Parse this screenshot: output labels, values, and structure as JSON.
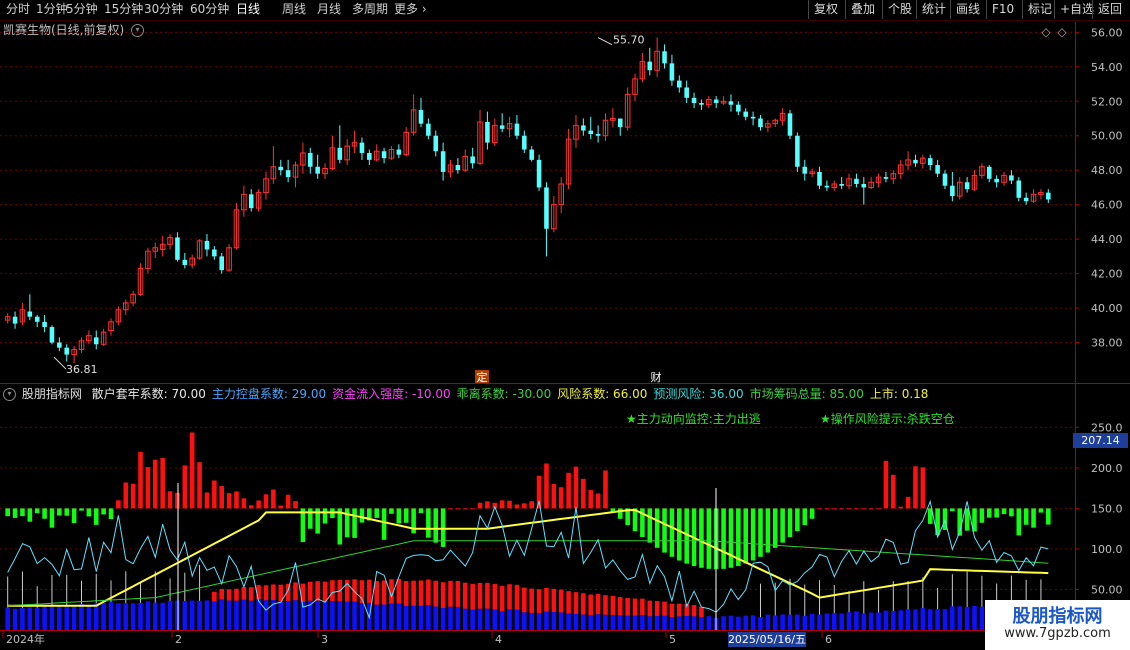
{
  "toolbar": {
    "periods": [
      "分时",
      "1分钟",
      "5分钟",
      "15分钟",
      "30分钟",
      "60分钟",
      "日线",
      "周线",
      "月线",
      "多周期",
      "更多"
    ],
    "active_period": "日线",
    "buttons": [
      "复权",
      "叠加",
      "个股",
      "统计",
      "画线",
      "F10",
      "标记",
      "+自选",
      "返回"
    ]
  },
  "stock": {
    "title": "凯赛生物(日线,前复权)"
  },
  "price_axis": {
    "ticks": [
      "56.00",
      "54.00",
      "52.00",
      "50.00",
      "48.00",
      "46.00",
      "44.00",
      "42.00",
      "40.00",
      "38.00"
    ]
  },
  "annotations": {
    "high": "55.70",
    "low": "36.81",
    "marker_ding": "定",
    "marker_cai": "财"
  },
  "indicator": {
    "name": "股朋指标网",
    "params": [
      {
        "label": "散户套牢系数: 70.00",
        "color": "#e8e8e8"
      },
      {
        "label": "主力控盘系数: 29.00",
        "color": "#4aa8ff"
      },
      {
        "label": "资金流入强度: -10.00",
        "color": "#ff40ff"
      },
      {
        "label": "乖离系数: -30.00",
        "color": "#40d040"
      },
      {
        "label": "风险系数: 66.00",
        "color": "#f0f040"
      },
      {
        "label": "预测风险: 36.00",
        "color": "#40d8d8"
      },
      {
        "label": "市场筹码总量: 85.00",
        "color": "#40d040"
      },
      {
        "label": "上市: 0.18",
        "color": "#f0f040"
      }
    ],
    "signal1": "★主力动向监控:主力出逃",
    "signal2": "★操作风险提示:杀跌空仓",
    "axis_ticks": [
      "250.0",
      "200.0",
      "150.0",
      "100.0",
      "50.00"
    ],
    "current_value": "207.14"
  },
  "date_axis": {
    "labels": [
      "2024年",
      "2",
      "3",
      "4",
      "5",
      "6"
    ],
    "highlight": "2025/05/16/五"
  },
  "watermark": {
    "line1": "股朋指标网",
    "line2": "www.7gpzb.com"
  },
  "colors": {
    "up": "#ff3232",
    "down": "#54ffff",
    "grid": "#6a0000",
    "axis": "#b00000",
    "red_bar": "#ff1010",
    "green_bar": "#10ff10",
    "blue_bar": "#1010ff",
    "yellow_line": "#ffff40",
    "cyan_line": "#60e0ff",
    "green_line": "#30d030"
  },
  "chart_data": {
    "type": "candlestick",
    "ylim": [
      36,
      56.6
    ],
    "candles": [
      [
        39.3,
        39.7,
        39.1,
        39.5
      ],
      [
        39.5,
        39.8,
        38.8,
        39.1
      ],
      [
        39.2,
        40.3,
        39.0,
        39.9
      ],
      [
        39.8,
        40.8,
        39.3,
        39.5
      ],
      [
        39.5,
        39.6,
        38.9,
        39.2
      ],
      [
        39.2,
        39.6,
        38.6,
        38.9
      ],
      [
        38.9,
        39.0,
        37.9,
        38.0
      ],
      [
        38.0,
        38.3,
        37.5,
        37.7
      ],
      [
        37.7,
        37.9,
        36.9,
        37.3
      ],
      [
        37.3,
        37.8,
        36.81,
        37.6
      ],
      [
        37.6,
        38.3,
        37.4,
        38.1
      ],
      [
        38.1,
        38.7,
        37.9,
        38.4
      ],
      [
        38.3,
        38.7,
        37.6,
        37.9
      ],
      [
        37.9,
        38.8,
        37.8,
        38.6
      ],
      [
        38.7,
        39.4,
        38.4,
        39.2
      ],
      [
        39.2,
        40.1,
        39.0,
        39.9
      ],
      [
        39.9,
        40.5,
        39.6,
        40.3
      ],
      [
        40.3,
        41.0,
        40.1,
        40.8
      ],
      [
        40.8,
        42.6,
        40.7,
        42.3
      ],
      [
        42.3,
        43.5,
        42.0,
        43.3
      ],
      [
        43.3,
        43.8,
        42.9,
        43.5
      ],
      [
        43.4,
        44.2,
        43.0,
        43.7
      ],
      [
        43.7,
        44.3,
        43.4,
        44.1
      ],
      [
        44.1,
        44.4,
        42.7,
        42.8
      ],
      [
        42.8,
        43.2,
        42.3,
        42.5
      ],
      [
        42.5,
        43.1,
        42.3,
        42.9
      ],
      [
        42.9,
        44.0,
        42.8,
        43.9
      ],
      [
        43.9,
        44.3,
        43.0,
        43.4
      ],
      [
        43.4,
        43.6,
        42.8,
        43.0
      ],
      [
        43.0,
        43.2,
        42.0,
        42.2
      ],
      [
        42.2,
        43.7,
        42.1,
        43.5
      ],
      [
        43.5,
        46.1,
        43.4,
        45.7
      ],
      [
        45.7,
        47.1,
        45.3,
        46.6
      ],
      [
        46.6,
        46.9,
        45.6,
        45.8
      ],
      [
        45.8,
        46.9,
        45.6,
        46.7
      ],
      [
        46.7,
        47.9,
        46.3,
        47.5
      ],
      [
        47.5,
        49.4,
        47.2,
        48.2
      ],
      [
        48.2,
        48.6,
        47.7,
        48.0
      ],
      [
        48.0,
        48.6,
        47.3,
        47.6
      ],
      [
        47.6,
        48.5,
        47.0,
        48.3
      ],
      [
        48.3,
        49.6,
        47.8,
        49.0
      ],
      [
        49.0,
        49.3,
        47.8,
        48.2
      ],
      [
        48.2,
        48.9,
        47.5,
        47.8
      ],
      [
        47.8,
        48.4,
        47.5,
        48.1
      ],
      [
        48.1,
        50.0,
        48.0,
        49.3
      ],
      [
        49.3,
        50.6,
        48.4,
        48.6
      ],
      [
        48.6,
        49.8,
        48.3,
        49.4
      ],
      [
        49.4,
        50.3,
        49.0,
        49.6
      ],
      [
        49.6,
        49.9,
        48.6,
        49.0
      ],
      [
        49.0,
        49.2,
        48.3,
        48.6
      ],
      [
        48.6,
        49.5,
        48.5,
        49.1
      ],
      [
        49.1,
        49.3,
        48.4,
        48.7
      ],
      [
        48.7,
        49.4,
        48.6,
        49.2
      ],
      [
        49.2,
        49.5,
        48.7,
        48.9
      ],
      [
        48.9,
        50.5,
        48.8,
        50.2
      ],
      [
        50.2,
        52.4,
        50.0,
        51.5
      ],
      [
        51.5,
        52.2,
        50.5,
        50.7
      ],
      [
        50.7,
        51.0,
        49.8,
        50.0
      ],
      [
        50.0,
        50.3,
        48.8,
        49.1
      ],
      [
        49.1,
        49.6,
        47.4,
        47.9
      ],
      [
        47.9,
        48.6,
        47.6,
        48.3
      ],
      [
        48.3,
        48.7,
        47.8,
        48.0
      ],
      [
        48.0,
        49.2,
        47.9,
        48.8
      ],
      [
        48.8,
        49.3,
        48.1,
        48.4
      ],
      [
        48.4,
        51.5,
        48.3,
        50.8
      ],
      [
        50.8,
        51.4,
        49.2,
        49.6
      ],
      [
        49.6,
        51.0,
        49.4,
        50.6
      ],
      [
        50.6,
        51.3,
        50.2,
        50.4
      ],
      [
        50.4,
        51.1,
        49.9,
        50.7
      ],
      [
        50.7,
        51.2,
        49.8,
        50.0
      ],
      [
        50.0,
        50.3,
        49.0,
        49.2
      ],
      [
        49.2,
        49.4,
        48.5,
        48.6
      ],
      [
        48.6,
        48.9,
        46.8,
        47.0
      ],
      [
        47.0,
        47.3,
        43.0,
        44.6
      ],
      [
        44.6,
        46.5,
        44.4,
        46.0
      ],
      [
        46.0,
        47.6,
        45.5,
        47.2
      ],
      [
        47.2,
        50.4,
        46.9,
        49.8
      ],
      [
        49.8,
        51.2,
        49.3,
        50.6
      ],
      [
        50.6,
        51.0,
        50.0,
        50.3
      ],
      [
        50.3,
        51.1,
        49.8,
        50.1
      ],
      [
        50.1,
        50.6,
        49.6,
        50.0
      ],
      [
        50.0,
        51.3,
        49.7,
        50.9
      ],
      [
        50.9,
        51.6,
        50.5,
        51.0
      ],
      [
        51.0,
        50.8,
        50.0,
        50.5
      ],
      [
        50.5,
        52.8,
        50.3,
        52.4
      ],
      [
        52.4,
        53.6,
        52.0,
        53.3
      ],
      [
        53.3,
        54.8,
        53.1,
        54.3
      ],
      [
        54.3,
        55.1,
        53.5,
        53.8
      ],
      [
        53.8,
        55.7,
        53.4,
        54.9
      ],
      [
        54.9,
        55.3,
        53.9,
        54.2
      ],
      [
        54.2,
        54.7,
        52.9,
        53.2
      ],
      [
        53.2,
        53.5,
        52.5,
        52.8
      ],
      [
        52.8,
        53.2,
        51.9,
        52.2
      ],
      [
        52.2,
        52.5,
        51.6,
        51.9
      ],
      [
        51.9,
        52.1,
        51.5,
        51.8
      ],
      [
        51.8,
        52.3,
        51.6,
        52.1
      ],
      [
        52.1,
        52.3,
        51.6,
        51.9
      ],
      [
        51.9,
        52.3,
        51.8,
        52.0
      ],
      [
        52.0,
        52.4,
        51.4,
        51.8
      ],
      [
        51.8,
        52.0,
        51.2,
        51.4
      ],
      [
        51.4,
        51.6,
        50.9,
        51.1
      ],
      [
        51.1,
        51.4,
        50.6,
        51.0
      ],
      [
        51.0,
        51.2,
        50.3,
        50.5
      ],
      [
        50.5,
        50.9,
        50.2,
        50.7
      ],
      [
        50.7,
        51.0,
        50.5,
        50.9
      ],
      [
        50.9,
        51.6,
        50.6,
        51.3
      ],
      [
        51.3,
        51.5,
        49.8,
        50.0
      ],
      [
        50.0,
        50.2,
        47.9,
        48.2
      ],
      [
        48.2,
        48.6,
        47.4,
        47.8
      ],
      [
        47.8,
        48.1,
        47.6,
        47.9
      ],
      [
        47.9,
        48.2,
        46.9,
        47.1
      ],
      [
        47.1,
        47.4,
        46.8,
        47.0
      ],
      [
        47.0,
        47.4,
        46.8,
        47.2
      ],
      [
        47.2,
        47.6,
        46.9,
        47.1
      ],
      [
        47.1,
        47.8,
        46.9,
        47.5
      ],
      [
        47.5,
        47.8,
        47.0,
        47.2
      ],
      [
        47.2,
        47.6,
        46.0,
        47.0
      ],
      [
        47.0,
        47.6,
        46.9,
        47.3
      ],
      [
        47.3,
        47.8,
        47.0,
        47.6
      ],
      [
        47.6,
        47.9,
        47.3,
        47.5
      ],
      [
        47.5,
        48.0,
        47.2,
        47.8
      ],
      [
        47.8,
        48.6,
        47.5,
        48.3
      ],
      [
        48.3,
        49.1,
        48.0,
        48.6
      ],
      [
        48.6,
        48.9,
        48.2,
        48.4
      ],
      [
        48.4,
        48.9,
        48.1,
        48.7
      ],
      [
        48.7,
        48.9,
        48.0,
        48.3
      ],
      [
        48.3,
        48.6,
        47.6,
        47.8
      ],
      [
        47.8,
        48.0,
        46.9,
        47.1
      ],
      [
        47.1,
        47.9,
        46.2,
        46.5
      ],
      [
        46.5,
        47.6,
        46.3,
        47.3
      ],
      [
        47.3,
        47.6,
        46.7,
        46.9
      ],
      [
        46.9,
        48.0,
        46.8,
        47.7
      ],
      [
        47.7,
        48.4,
        47.5,
        48.2
      ],
      [
        48.2,
        48.3,
        47.3,
        47.5
      ],
      [
        47.5,
        47.7,
        47.0,
        47.3
      ],
      [
        47.3,
        47.9,
        47.1,
        47.7
      ],
      [
        47.7,
        48.0,
        47.2,
        47.4
      ],
      [
        47.4,
        47.6,
        46.2,
        46.4
      ],
      [
        46.4,
        46.7,
        46.0,
        46.2
      ],
      [
        46.2,
        46.9,
        46.1,
        46.6
      ],
      [
        46.6,
        46.9,
        46.3,
        46.7
      ],
      [
        46.7,
        46.9,
        46.1,
        46.3
      ]
    ]
  }
}
